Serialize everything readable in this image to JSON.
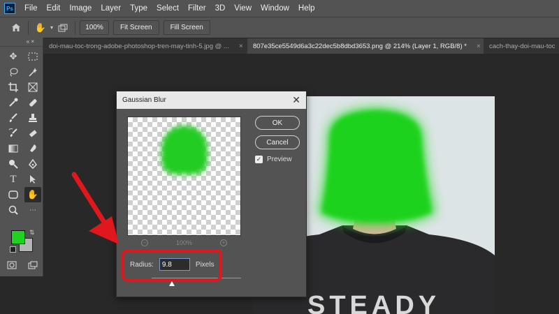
{
  "app": {
    "logo": "Ps"
  },
  "menu": [
    "File",
    "Edit",
    "Image",
    "Layer",
    "Type",
    "Select",
    "Filter",
    "3D",
    "View",
    "Window",
    "Help"
  ],
  "options_bar": {
    "zoom": "100%",
    "fit_screen": "Fit Screen",
    "fill_screen": "Fill Screen"
  },
  "toolbar": {
    "collapse_label": "« ×"
  },
  "tabs": [
    {
      "label": "doi-mau-toc-trong-adobe-photoshop-tren-may-tinh-5.jpg @ ...",
      "close": "×"
    },
    {
      "label": "807e35ce5549d6a3c22dec5b8dbd3653.png @ 214% (Layer 1, RGB/8) *",
      "close": "×"
    },
    {
      "label": "cach-thay-doi-mau-toc",
      "close": ""
    }
  ],
  "colors": {
    "foreground": "#1fd21f",
    "background": "#b5b5b5",
    "accent": "#e0171d"
  },
  "dialog": {
    "title": "Gaussian Blur",
    "ok": "OK",
    "cancel": "Cancel",
    "preview_label": "Preview",
    "preview_checked": true,
    "zoom": "100%",
    "radius_label": "Radius:",
    "radius_value": "9.8",
    "units": "Pixels"
  },
  "canvas": {
    "shirt_text": "STEADY"
  }
}
